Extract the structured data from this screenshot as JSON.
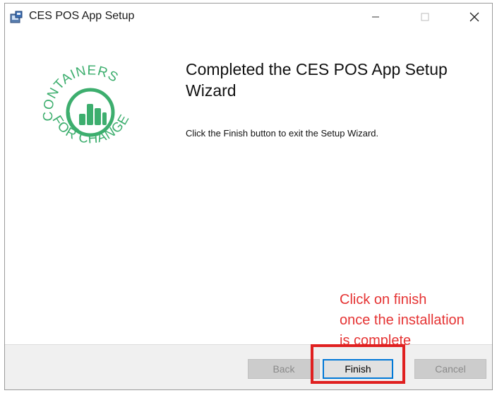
{
  "window": {
    "title": "CES POS App Setup",
    "controls": {
      "minimize_icon": "minimize-icon",
      "maximize_icon": "maximize-icon",
      "close_icon": "close-icon"
    }
  },
  "logo": {
    "text_top": "CONTAINERS",
    "text_bottom": "FOR CHANGE",
    "color": "#3dae6e"
  },
  "content": {
    "heading": "Completed the CES POS App Setup Wizard",
    "message": "Click the Finish button to exit the Setup Wizard."
  },
  "annotation": {
    "text": "Click on finish\nonce the installation\nis complete",
    "color": "#e53333"
  },
  "buttons": {
    "back": "Back",
    "finish": "Finish",
    "cancel": "Cancel"
  },
  "colors": {
    "accent": "#0078d7",
    "highlight": "#e02020"
  }
}
